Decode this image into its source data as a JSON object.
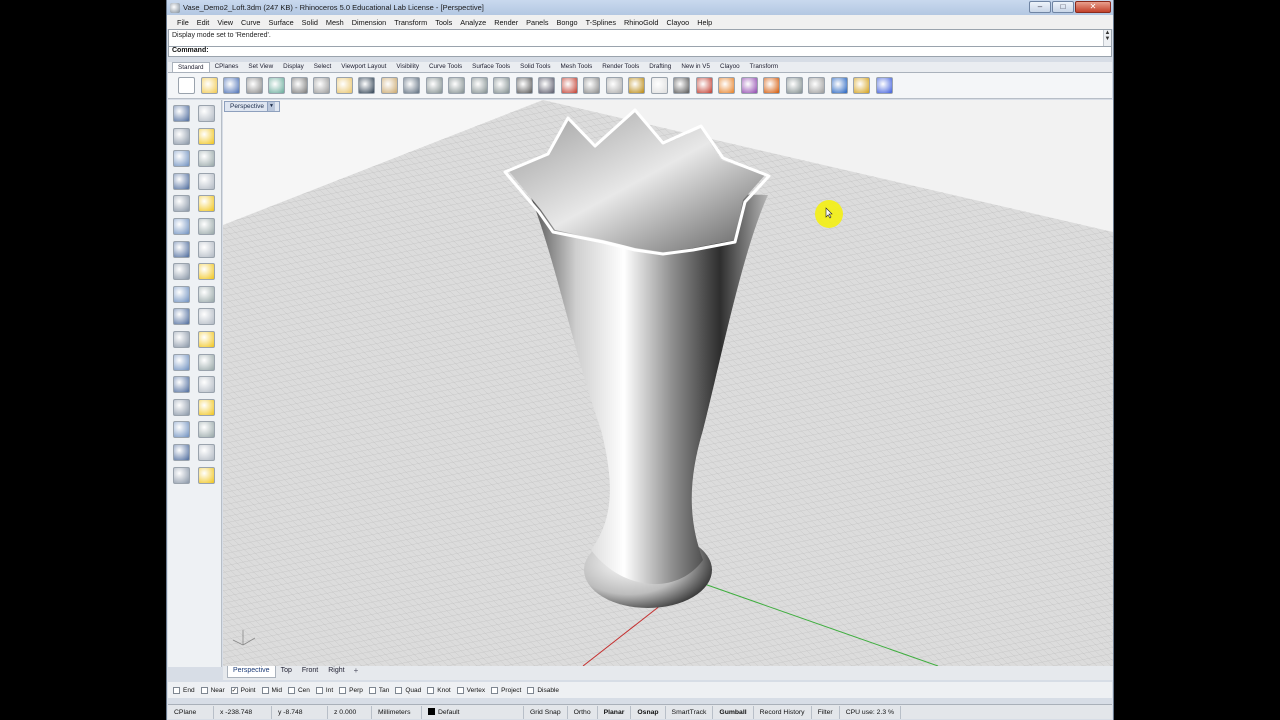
{
  "window": {
    "title": "Vase_Demo2_Loft.3dm (247 KB) - Rhinoceros 5.0 Educational Lab License - [Perspective]"
  },
  "menu": [
    "File",
    "Edit",
    "View",
    "Curve",
    "Surface",
    "Solid",
    "Mesh",
    "Dimension",
    "Transform",
    "Tools",
    "Analyze",
    "Render",
    "Panels",
    "Bongo",
    "T-Splines",
    "RhinoGold",
    "Clayoo",
    "Help"
  ],
  "command": {
    "history": "Display mode set to 'Rendered'.",
    "prompt": "Command:"
  },
  "tool_tabs": [
    "Standard",
    "CPlanes",
    "Set View",
    "Display",
    "Select",
    "Viewport Layout",
    "Visibility",
    "Curve Tools",
    "Surface Tools",
    "Solid Tools",
    "Mesh Tools",
    "Render Tools",
    "Drafting",
    "New in V5",
    "Clayoo",
    "Transform"
  ],
  "viewport": {
    "label": "Perspective"
  },
  "viewport_tabs": [
    "Perspective",
    "Top",
    "Front",
    "Right"
  ],
  "osnaps": [
    {
      "label": "End",
      "checked": false
    },
    {
      "label": "Near",
      "checked": false
    },
    {
      "label": "Point",
      "checked": true
    },
    {
      "label": "Mid",
      "checked": false
    },
    {
      "label": "Cen",
      "checked": false
    },
    {
      "label": "Int",
      "checked": false
    },
    {
      "label": "Perp",
      "checked": false
    },
    {
      "label": "Tan",
      "checked": false
    },
    {
      "label": "Quad",
      "checked": false
    },
    {
      "label": "Knot",
      "checked": false
    },
    {
      "label": "Vertex",
      "checked": false
    },
    {
      "label": "Project",
      "checked": false
    },
    {
      "label": "Disable",
      "checked": false
    }
  ],
  "status": {
    "cplane": "CPlane",
    "x": "x -238.748",
    "y": "y -8.748",
    "z": "z 0.000",
    "units": "Millimeters",
    "layer": "Default",
    "toggles": [
      "Grid Snap",
      "Ortho",
      "Planar",
      "Osnap",
      "SmartTrack",
      "Gumball",
      "Record History",
      "Filter"
    ],
    "cpu": "CPU use: 2.3 %"
  },
  "colors": {
    "accent": "#1b3b77",
    "highlight": "#f2ee1b"
  }
}
